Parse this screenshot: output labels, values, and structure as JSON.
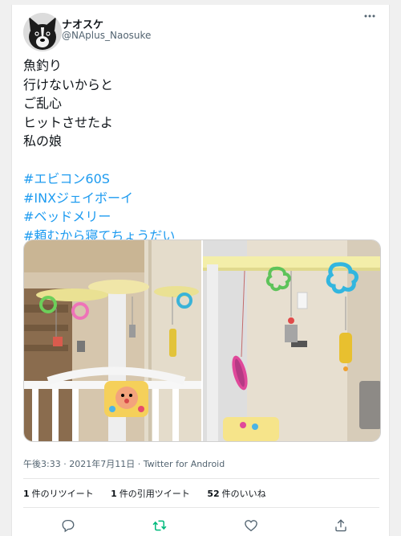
{
  "author": {
    "display_name": "ナオスケ",
    "handle": "@NAplus_Naosuke"
  },
  "menu_icon": "more-horizontal-icon",
  "tweet": {
    "lines": [
      "魚釣り",
      "行けないからと",
      "ご乱心",
      "ヒットさせたよ",
      "私の娘"
    ],
    "hashtags": [
      "#エビコン60S",
      "#INXジェイボーイ",
      "#ベッドメリー",
      "#頼むから寝てちょうだい"
    ]
  },
  "photos": [
    {
      "name": "baby-mobile-with-lures-photo-1"
    },
    {
      "name": "baby-mobile-with-lures-photo-2"
    }
  ],
  "meta": {
    "time": "午後3:33",
    "date": "2021年7月11日",
    "source": "Twitter for Android",
    "separator": "·"
  },
  "stats": {
    "retweets": {
      "count": "1",
      "label": "件のリツイート"
    },
    "quotes": {
      "count": "1",
      "label": "件の引用ツイート"
    },
    "likes": {
      "count": "52",
      "label": "件のいいね"
    }
  },
  "actions": [
    {
      "name": "reply-button",
      "icon": "reply-icon"
    },
    {
      "name": "retweet-button",
      "icon": "retweet-icon"
    },
    {
      "name": "like-button",
      "icon": "heart-icon"
    },
    {
      "name": "share-button",
      "icon": "share-icon"
    }
  ],
  "colors": {
    "accent": "#1d9bf0",
    "retweet_active": "#00ba7c",
    "muted": "#536471"
  }
}
